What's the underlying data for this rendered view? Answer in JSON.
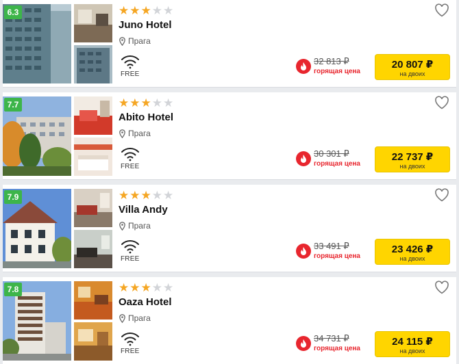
{
  "hotels": [
    {
      "rating": "6.3",
      "stars": 3,
      "max_stars": 5,
      "name": "Juno Hotel",
      "location": "Прага",
      "wifi_label": "FREE",
      "old_price": "32 813 ₽",
      "hot_label": "горящая цена",
      "price": "20 807 ₽",
      "price_note": "на двоих"
    },
    {
      "rating": "7.7",
      "stars": 3,
      "max_stars": 5,
      "name": "Abito Hotel",
      "location": "Прага",
      "wifi_label": "FREE",
      "old_price": "30 301 ₽",
      "hot_label": "горящая цена",
      "price": "22 737 ₽",
      "price_note": "на двоих"
    },
    {
      "rating": "7.9",
      "stars": 3,
      "max_stars": 5,
      "name": "Villa Andy",
      "location": "Прага",
      "wifi_label": "FREE",
      "old_price": "33 491 ₽",
      "hot_label": "горящая цена",
      "price": "23 426 ₽",
      "price_note": "на двоих"
    },
    {
      "rating": "7.8",
      "stars": 3,
      "max_stars": 5,
      "name": "Oaza Hotel",
      "location": "Прага",
      "wifi_label": "FREE",
      "old_price": "34 731 ₽",
      "hot_label": "горящая цена",
      "price": "24 115 ₽",
      "price_note": "на двоих"
    }
  ],
  "colors": {
    "rating_badge": "#3db54a",
    "star_on": "#f5a623",
    "star_off": "#d2d4d8",
    "hot": "#e8262e",
    "price_button": "#ffd500"
  },
  "icons": {
    "location": "map-pin-icon",
    "wifi": "wifi-icon",
    "favorite": "heart-outline-icon",
    "hot_price": "fire-icon"
  }
}
